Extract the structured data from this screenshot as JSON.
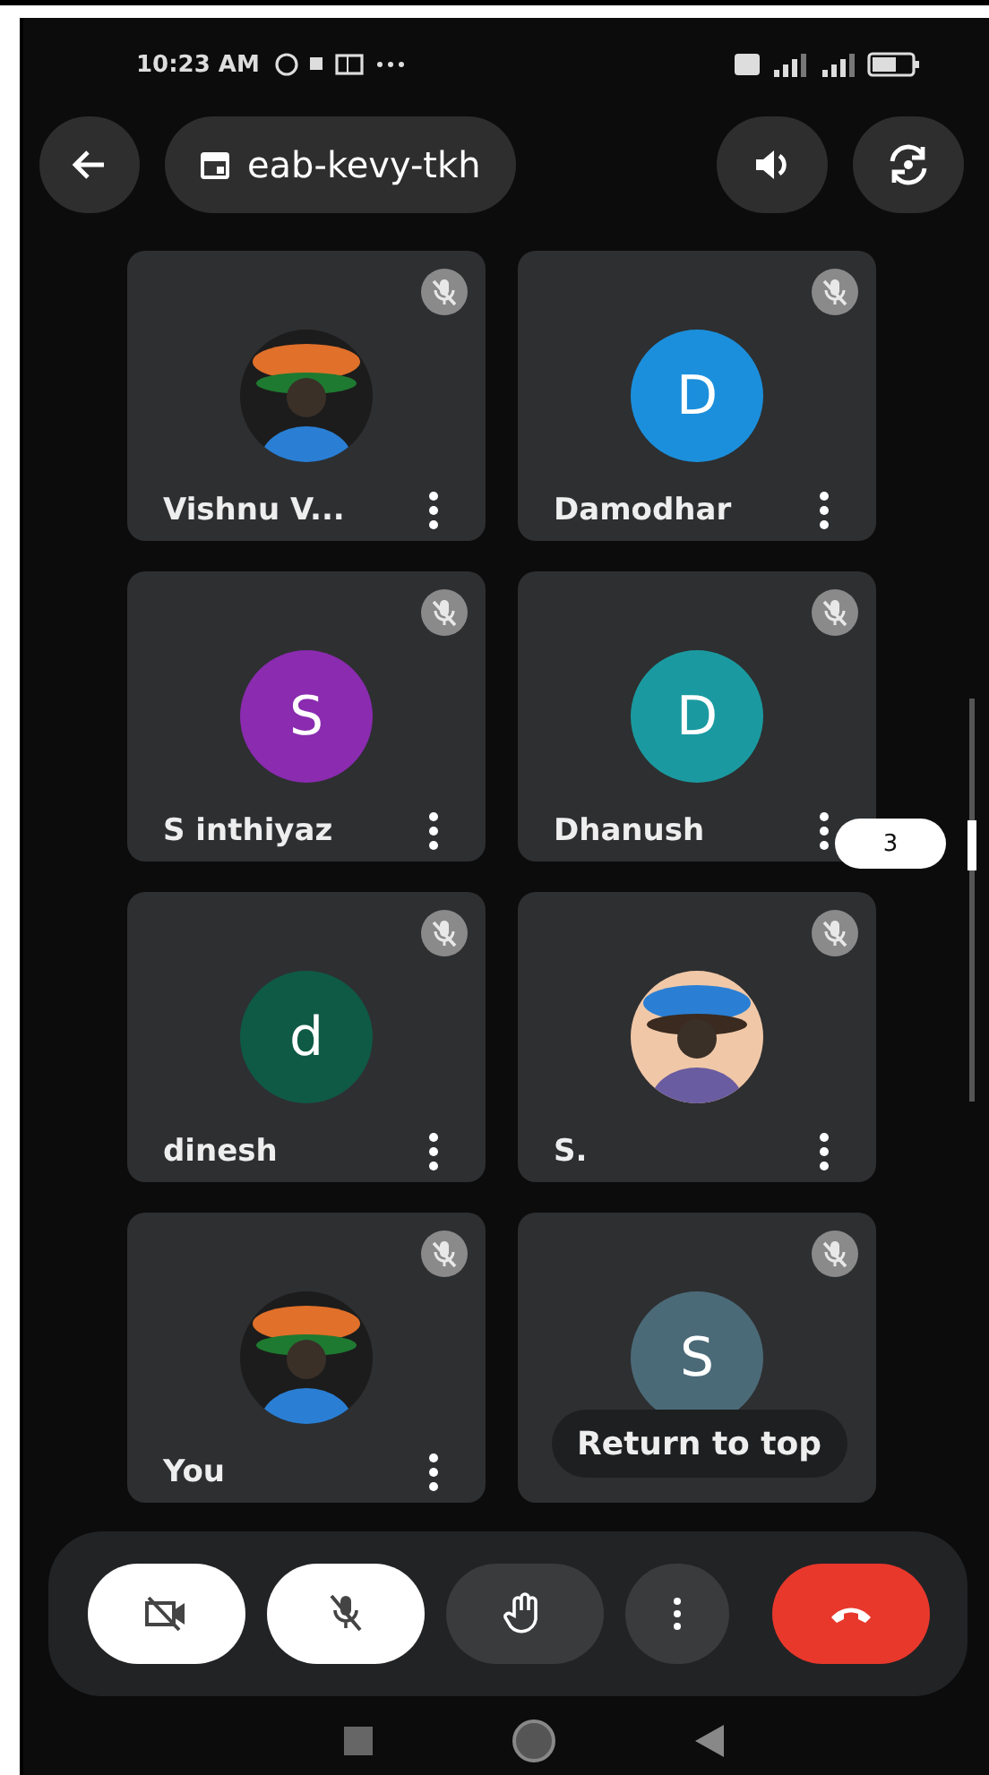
{
  "status_bar": {
    "time": "10:23 AM"
  },
  "meeting": {
    "code": "eab-kevy-tkh"
  },
  "participants": [
    {
      "name": "Vishnu V...",
      "muted": true,
      "menu": true
    },
    {
      "name": "Damodhar",
      "avatar": {
        "kind": "letter",
        "letter": "D",
        "color": "#1b8fdc"
      },
      "muted": true,
      "menu": true
    },
    {
      "name": "S inthiyaz",
      "avatar": {
        "kind": "letter",
        "letter": "S",
        "color": "#8a2bb0"
      },
      "muted": true,
      "menu": true
    },
    {
      "name": "Dhanush",
      "avatar": {
        "kind": "letter",
        "letter": "D",
        "color": "#1a9aa0"
      },
      "muted": true,
      "menu": true
    },
    {
      "name": "dinesh",
      "avatar": {
        "kind": "letter",
        "letter": "d",
        "color": "#0f5a45"
      },
      "muted": true,
      "menu": true
    },
    {
      "name": "S.",
      "muted": true,
      "menu": true
    },
    {
      "name": "You",
      "muted": true,
      "menu": true
    },
    {
      "avatar": {
        "kind": "letter",
        "letter": "S",
        "color": "#4b6a78"
      },
      "muted": true,
      "menu": false
    }
  ],
  "scroll_indicator": {
    "page": "3"
  },
  "return_to_top": "Return to top",
  "controls": [
    {
      "kind": "camera",
      "on": false
    },
    {
      "kind": "microphone",
      "on": false
    },
    {
      "kind": "raise_hand"
    },
    {
      "kind": "more"
    },
    {
      "kind": "end_call"
    }
  ]
}
